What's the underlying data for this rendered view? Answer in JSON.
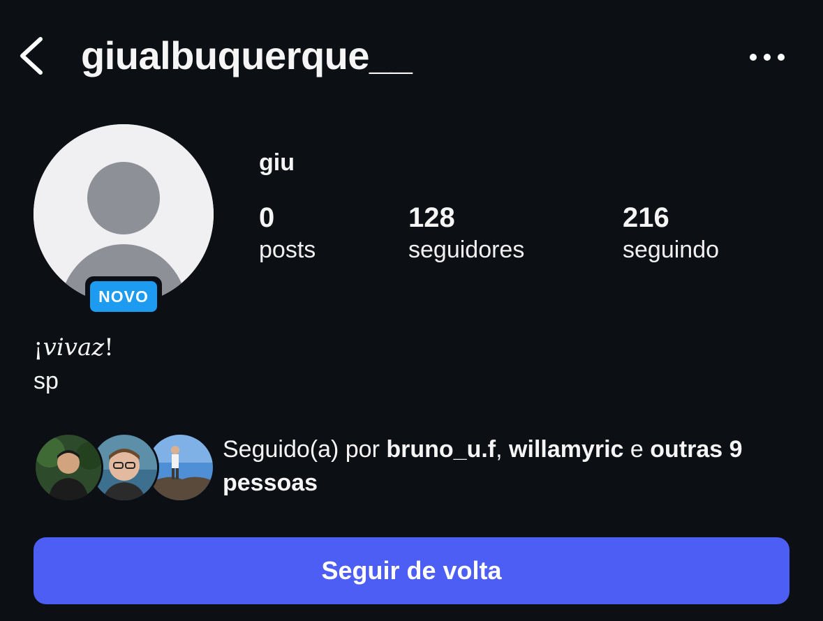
{
  "header": {
    "username": "giualbuquerque__",
    "back_icon": "chevron-left-icon",
    "more_icon": "more-horizontal-icon"
  },
  "profile": {
    "display_name": "giu",
    "badge": "NOVO",
    "badge_color": "#1d9bf0",
    "stats": [
      {
        "value": "0",
        "label": "posts"
      },
      {
        "value": "128",
        "label": "seguidores"
      },
      {
        "value": "216",
        "label": "seguindo"
      }
    ],
    "bio": {
      "line1_prefix": "¡",
      "line1_italic": "vivaz",
      "line1_suffix": "!",
      "line2": "sp"
    }
  },
  "followed_by": {
    "prefix": "Seguido(a) por ",
    "user1": "bruno_u.f",
    "separator": ", ",
    "user2": "willamyric",
    "conjunction": " e ",
    "others": "outras 9 pessoas"
  },
  "actions": {
    "follow_back_label": "Seguir de volta",
    "button_color": "#4d5ef5"
  }
}
